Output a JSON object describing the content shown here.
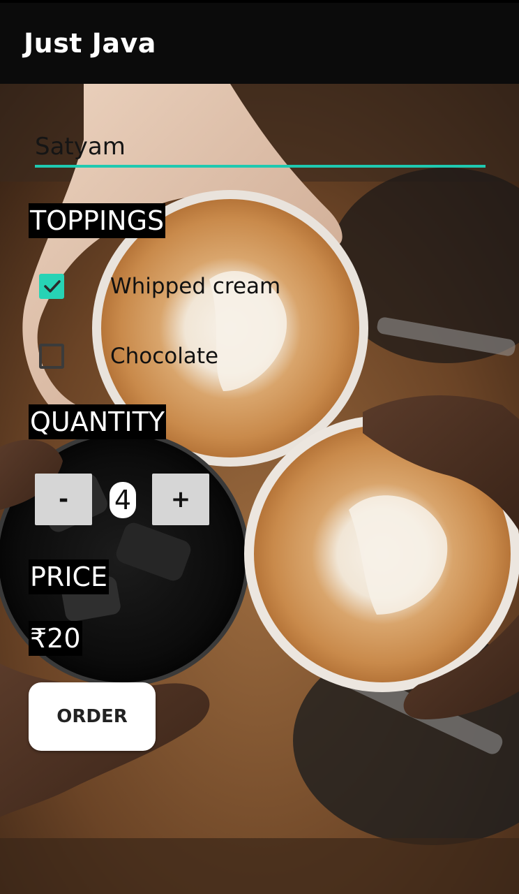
{
  "app": {
    "title": "Just Java"
  },
  "form": {
    "name_value": "Satyam",
    "toppings_label": "TOPPINGS",
    "toppings": [
      {
        "label": "Whipped cream",
        "checked": true
      },
      {
        "label": "Chocolate",
        "checked": false
      }
    ],
    "quantity_label": "QUANTITY",
    "decrement_label": "-",
    "quantity_value": "4",
    "increment_label": "+",
    "price_label": "PRICE",
    "price_value": "₹20",
    "order_label": "ORDER"
  },
  "colors": {
    "accent": "#1fc9b0",
    "appbar": "#0b0b0b"
  },
  "icons": {
    "check": "check-icon"
  }
}
